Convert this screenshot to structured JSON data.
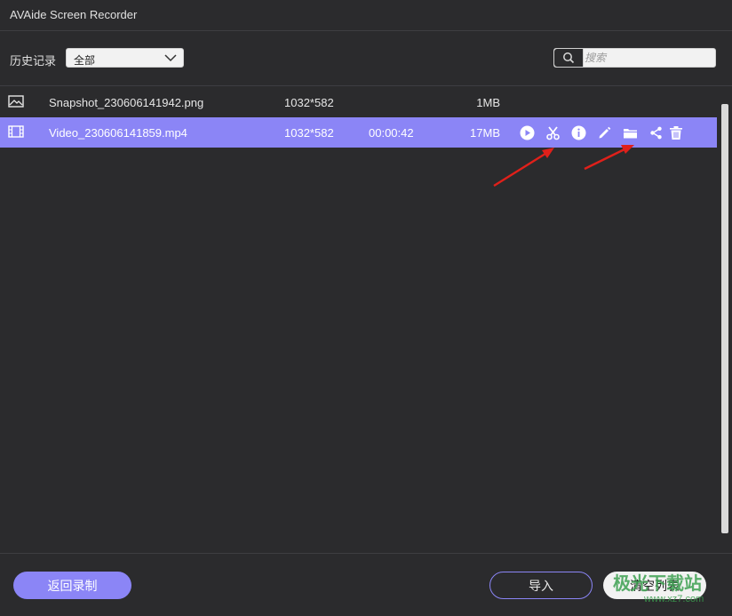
{
  "window": {
    "title": "AVAide Screen Recorder"
  },
  "filter": {
    "history_label": "历史记录",
    "select_value": "全部",
    "search_placeholder": "搜索"
  },
  "files": [
    {
      "name": "Snapshot_230606141942.png",
      "resolution": "1032*582",
      "duration": "",
      "size": "1MB",
      "type_icon": "image-icon",
      "selected": false
    },
    {
      "name": "Video_230606141859.mp4",
      "resolution": "1032*582",
      "duration": "00:00:42",
      "size": "17MB",
      "type_icon": "video-icon",
      "selected": true
    }
  ],
  "row_actions": [
    "play-icon",
    "cut-icon",
    "info-icon",
    "edit-icon",
    "folder-icon",
    "share-icon",
    "delete-icon"
  ],
  "footer": {
    "back_label": "返回录制",
    "import_label": "导入",
    "clear_label": "清空列表"
  },
  "watermark": {
    "text": "极光下载站",
    "sub": "www.xz7.com"
  },
  "colors": {
    "accent": "#8b85f6",
    "background": "#2b2b2d",
    "annotation_arrow": "#e0201a"
  }
}
